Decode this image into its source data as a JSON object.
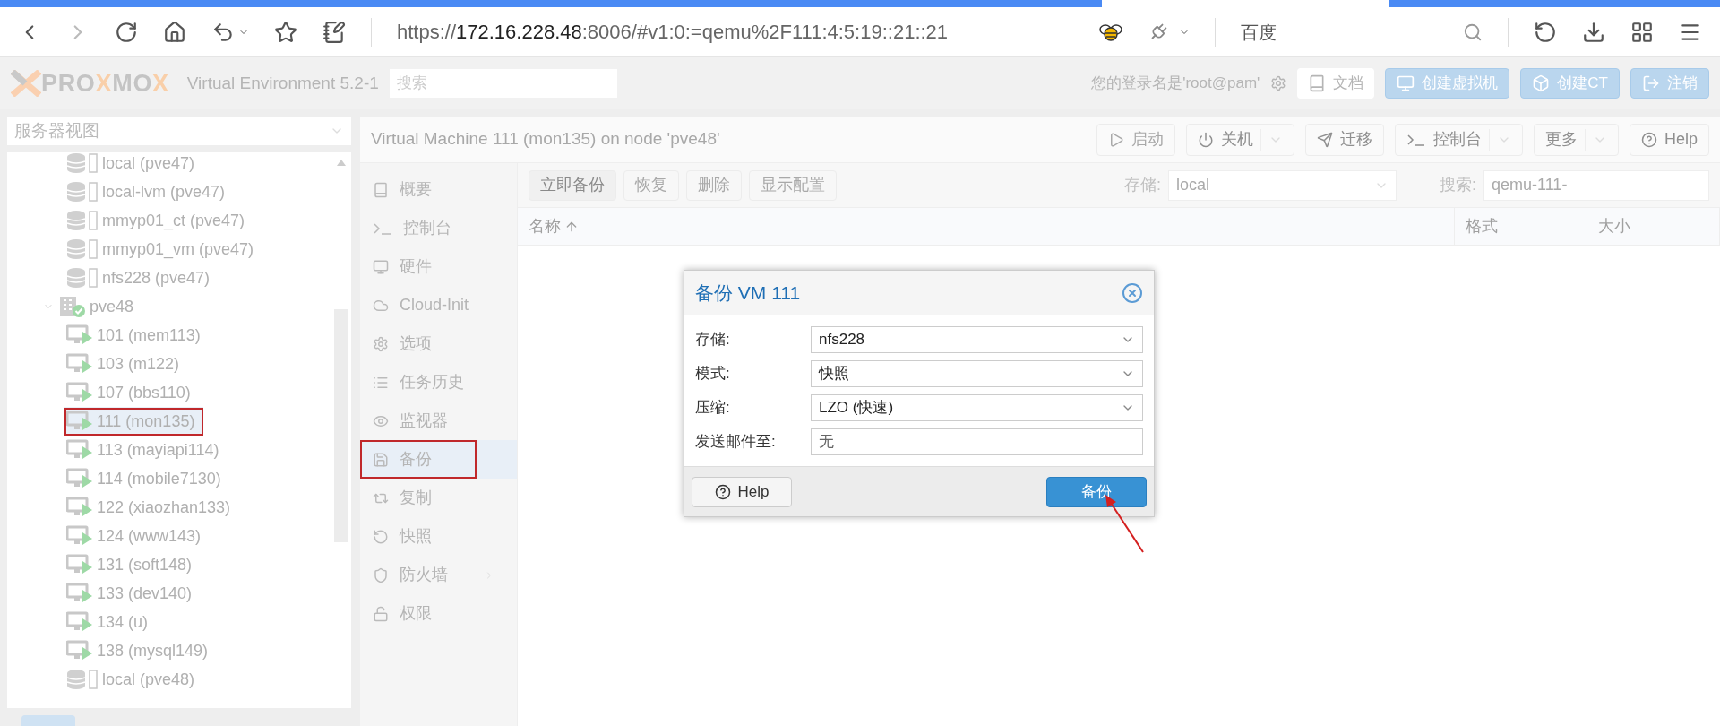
{
  "browser": {
    "url": {
      "scheme": "https://",
      "host": "172.16.228.48",
      "rest": ":8006/#v1:0:=qemu%2F111:4:5:19::21::21"
    },
    "search_engine": "百度"
  },
  "header": {
    "logo": [
      {
        "text": "PRO",
        "kind": "plain"
      },
      {
        "text": "X",
        "kind": "accent"
      },
      {
        "text": "MO",
        "kind": "plain"
      },
      {
        "text": "X",
        "kind": "accent"
      }
    ],
    "product": "Virtual Environment 5.2-1",
    "search_placeholder": "搜索",
    "login": "您的登录名是'root@pam'",
    "buttons": [
      {
        "label": "文档",
        "kind": "docs"
      },
      {
        "label": "创建虚拟机",
        "kind": "vm"
      },
      {
        "label": "创建CT",
        "kind": "ct"
      },
      {
        "label": "注销",
        "kind": "logout"
      }
    ]
  },
  "sidebar": {
    "view": "服务器视图",
    "tree": [
      {
        "kind": "continued",
        "children": [
          {
            "kind": "storage",
            "label": "local (pve47)",
            "selected": false,
            "annotated": false
          },
          {
            "kind": "storage",
            "label": "local-lvm (pve47)",
            "selected": false,
            "annotated": false
          },
          {
            "kind": "storage",
            "label": "mmyp01_ct (pve47)",
            "selected": false,
            "annotated": false
          },
          {
            "kind": "storage",
            "label": "mmyp01_vm (pve47)",
            "selected": false,
            "annotated": false
          },
          {
            "kind": "storage",
            "label": "nfs228 (pve47)",
            "selected": false,
            "annotated": false
          }
        ]
      },
      {
        "kind": "node",
        "label": "pve48",
        "expanded": true,
        "selected": false,
        "annotated": false,
        "children": [
          {
            "kind": "vm",
            "label": "101 (mem113)",
            "selected": false,
            "annotated": false
          },
          {
            "kind": "vm",
            "label": "103 (m122)",
            "selected": false,
            "annotated": false
          },
          {
            "kind": "vm",
            "label": "107 (bbs110)",
            "selected": false,
            "annotated": false
          },
          {
            "kind": "vm",
            "label": "111 (mon135)",
            "selected": true,
            "annotated": true
          },
          {
            "kind": "vm",
            "label": "113 (mayiapi114)",
            "selected": false,
            "annotated": false
          },
          {
            "kind": "vm",
            "label": "114 (mobile7130)",
            "selected": false,
            "annotated": false
          },
          {
            "kind": "vm",
            "label": "122 (xiaozhan133)",
            "selected": false,
            "annotated": false
          },
          {
            "kind": "vm",
            "label": "124 (www143)",
            "selected": false,
            "annotated": false
          },
          {
            "kind": "vm",
            "label": "131 (soft148)",
            "selected": false,
            "annotated": false
          },
          {
            "kind": "vm",
            "label": "133 (dev140)",
            "selected": false,
            "annotated": false
          },
          {
            "kind": "vm",
            "label": "134 (u)",
            "selected": false,
            "annotated": false
          },
          {
            "kind": "vm",
            "label": "138 (mysql149)",
            "selected": false,
            "annotated": false
          },
          {
            "kind": "storage",
            "label": "local (pve48)",
            "selected": false,
            "annotated": false
          }
        ]
      }
    ]
  },
  "content": {
    "title": "Virtual Machine 111 (mon135) on node 'pve48'",
    "toolbar": [
      {
        "label": "启动",
        "kind": "start",
        "disabled": true,
        "dropdown": false
      },
      {
        "label": "关机",
        "kind": "shutdown",
        "disabled": false,
        "dropdown": true
      },
      {
        "label": "迁移",
        "kind": "migrate",
        "disabled": false,
        "dropdown": false
      },
      {
        "label": "控制台",
        "kind": "console",
        "disabled": false,
        "dropdown": true
      },
      {
        "label": "更多",
        "kind": "more",
        "disabled": false,
        "dropdown": true
      },
      {
        "label": "Help",
        "kind": "help",
        "disabled": false,
        "dropdown": false
      }
    ],
    "nav": [
      {
        "label": "概要",
        "kind": "summary",
        "selected": false,
        "annotated": false,
        "expandable": false
      },
      {
        "label": "控制台",
        "kind": "console",
        "selected": false,
        "annotated": false,
        "expandable": false
      },
      {
        "label": "硬件",
        "kind": "hardware",
        "selected": false,
        "annotated": false,
        "expandable": false
      },
      {
        "label": "Cloud-Init",
        "kind": "cloud",
        "selected": false,
        "annotated": false,
        "expandable": false
      },
      {
        "label": "选项",
        "kind": "options",
        "selected": false,
        "annotated": false,
        "expandable": false
      },
      {
        "label": "任务历史",
        "kind": "tasks",
        "selected": false,
        "annotated": false,
        "expandable": false
      },
      {
        "label": "监视器",
        "kind": "monitor",
        "selected": false,
        "annotated": false,
        "expandable": false
      },
      {
        "label": "备份",
        "kind": "backup",
        "selected": true,
        "annotated": true,
        "expandable": false
      },
      {
        "label": "复制",
        "kind": "replication",
        "selected": false,
        "annotated": false,
        "expandable": false
      },
      {
        "label": "快照",
        "kind": "snapshot",
        "selected": false,
        "annotated": false,
        "expandable": false
      },
      {
        "label": "防火墙",
        "kind": "firewall",
        "selected": false,
        "annotated": false,
        "expandable": true
      },
      {
        "label": "权限",
        "kind": "permissions",
        "selected": false,
        "annotated": false,
        "expandable": false
      }
    ],
    "backup_toolbar": [
      {
        "label": "立即备份",
        "disabled": false
      },
      {
        "label": "恢复",
        "disabled": true
      },
      {
        "label": "删除",
        "disabled": true
      },
      {
        "label": "显示配置",
        "disabled": true
      }
    ],
    "storage_label": "存储:",
    "storage_value": "local",
    "search_label": "搜索:",
    "search_value": "qemu-111-",
    "columns": [
      {
        "label": "名称",
        "sorted": true
      },
      {
        "label": "格式",
        "sorted": false
      },
      {
        "label": "大小",
        "sorted": false
      }
    ]
  },
  "dialog": {
    "title": "备份 VM 111",
    "fields": [
      {
        "label": "存储:",
        "kind": "select",
        "value": "nfs228"
      },
      {
        "label": "模式:",
        "kind": "select",
        "value": "快照"
      },
      {
        "label": "压缩:",
        "kind": "select",
        "value": "LZO (快速)"
      },
      {
        "label": "发送邮件至:",
        "kind": "text",
        "placeholder": "无"
      }
    ],
    "help": "Help",
    "submit": "备份",
    "submit_annotated": true
  }
}
